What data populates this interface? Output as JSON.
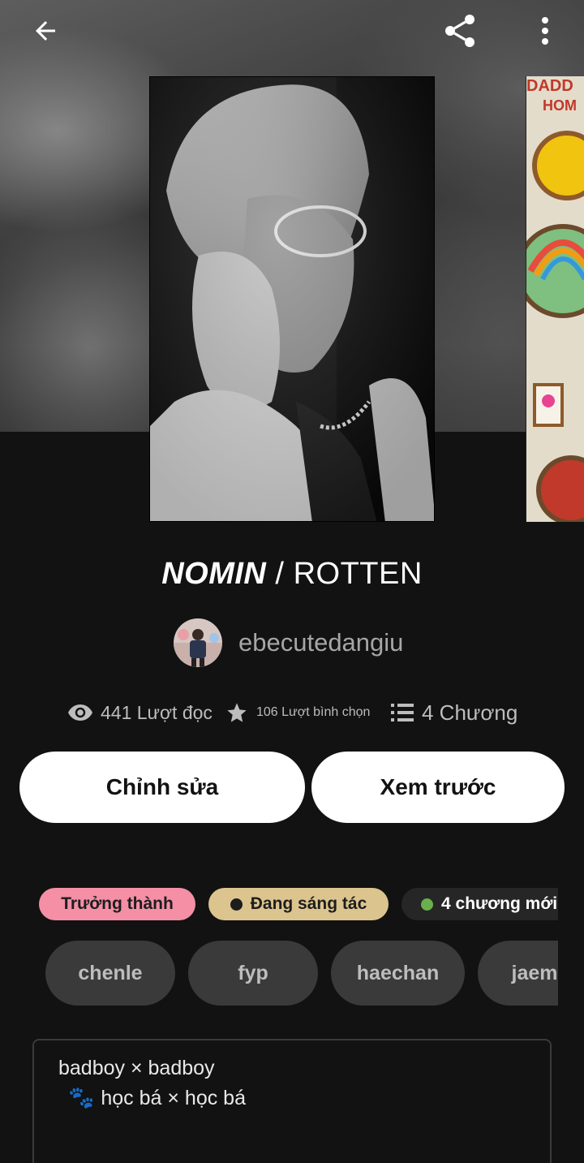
{
  "header": {
    "back_icon": "arrow-left-icon",
    "share_icon": "share-icon",
    "more_icon": "more-vertical-icon"
  },
  "story": {
    "title_bold": "NOMIN",
    "title_sep": " / ",
    "title_rest": "ROTTEN",
    "author": "ebecutedangiu"
  },
  "stats": {
    "reads": "441 Lượt đọc",
    "votes": "106 Lượt bình chọn",
    "parts": "4 Chương"
  },
  "actions": {
    "edit_label": "Chỉnh sửa",
    "preview_label": "Xem trước"
  },
  "badges": {
    "mature": "Trưởng thành",
    "ongoing": "Đang sáng tác",
    "new_parts": "4 chương mới"
  },
  "tags": [
    "chenle",
    "fyp",
    "haechan",
    "jaem"
  ],
  "description": {
    "line1": "badboy × badboy",
    "line2": "học bá × học bá"
  },
  "colors": {
    "background": "#121212",
    "mature_badge": "#f48fa6",
    "ongoing_badge": "#dcc48e",
    "new_dot": "#6ab04c",
    "tag_bg": "#3a3a3a"
  }
}
